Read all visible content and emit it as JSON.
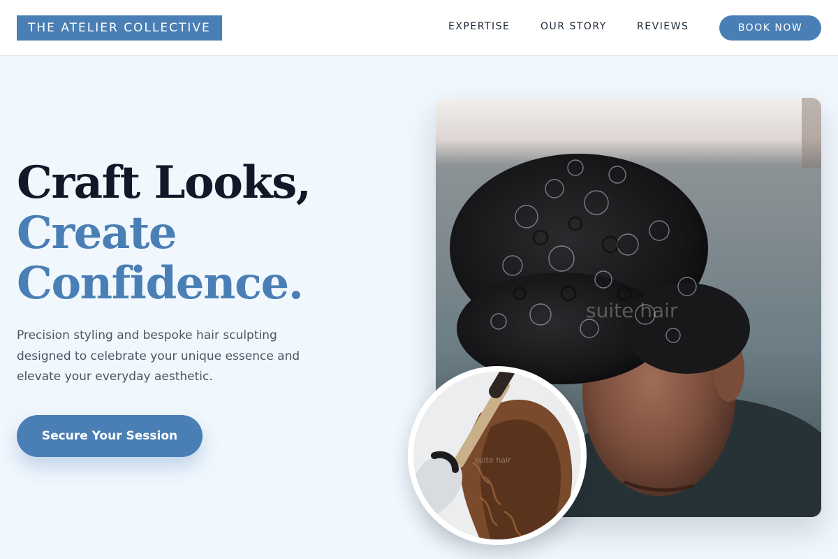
{
  "header": {
    "logo": "THE ATELIER COLLECTIVE",
    "nav": [
      "EXPERTISE",
      "OUR STORY",
      "REVIEWS"
    ],
    "cta": "BOOK NOW"
  },
  "hero": {
    "headline_line1": "Craft Looks,",
    "headline_line2": "Create",
    "headline_line3": "Confidence.",
    "subtext": "Precision styling and bespoke hair sculpting designed to celebrate your unique essence and elevate your everyday aesthetic.",
    "cta": "Secure Your Session"
  },
  "images": {
    "main_watermark": "suite hair",
    "circle_watermark": "suite hair"
  },
  "colors": {
    "accent": "#4a7fb5",
    "headline_dark": "#111827",
    "background": "#f0f7fd",
    "body_text": "#4b5563"
  }
}
